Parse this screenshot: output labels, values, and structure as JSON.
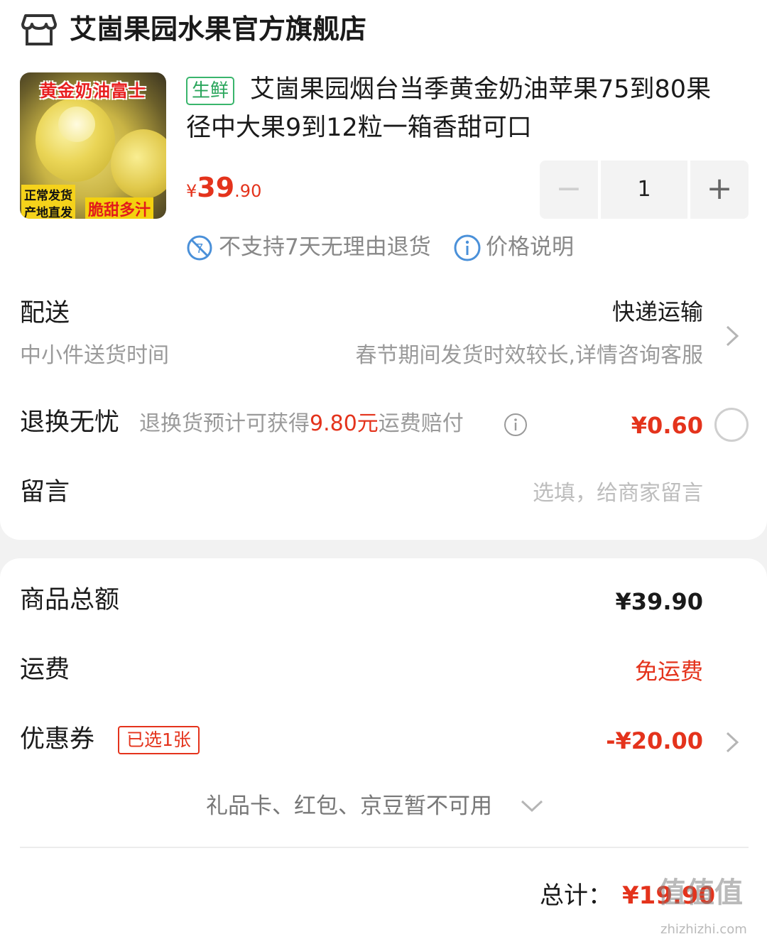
{
  "store": {
    "icon": "store-icon",
    "name": "艾崮果园水果官方旗舰店"
  },
  "product": {
    "image_banner": "黄金奶油富士",
    "image_tag_ship": "正常发货",
    "image_tag_origin": "产地直发",
    "image_tag_taste": "脆甜多汁",
    "fresh_tag": "生鲜",
    "title_line1": "艾崮果园烟台当季黄金奶油苹果75到80果",
    "title_line2": "径中大果9到12粒一箱香甜可口",
    "price_symbol": "¥",
    "price_int": "39",
    "price_dec": ".90",
    "quantity": "1",
    "minus_label": "−",
    "plus_label": "+",
    "no_return_text": "不支持7天无理由退货",
    "price_info_text": "价格说明",
    "accent_color": "#e4331c",
    "fresh_color": "#29a55b"
  },
  "delivery": {
    "label": "配送",
    "method": "快递运输",
    "sub_label": "中小件送货时间",
    "note": "春节期间发货时效较长,详情咨询客服"
  },
  "return_worry": {
    "label": "退换无忧",
    "desc_prefix": "退换货预计可获得",
    "desc_amount": "9.80元",
    "desc_suffix": "运费赔付",
    "price": "¥0.60"
  },
  "message": {
    "label": "留言",
    "placeholder": "选填，给商家留言"
  },
  "summary": {
    "goods_total_label": "商品总额",
    "goods_total_value": "¥39.90",
    "shipping_label": "运费",
    "shipping_value": "免运费",
    "coupon_label": "优惠券",
    "coupon_tag": "已选1张",
    "coupon_value": "-¥20.00",
    "unavailable_text": "礼品卡、红包、京豆暂不可用",
    "total_label": "总计：",
    "total_value": "¥19.90"
  },
  "watermark": {
    "text": "值值值",
    "sub": "zhizhizhi.com"
  }
}
